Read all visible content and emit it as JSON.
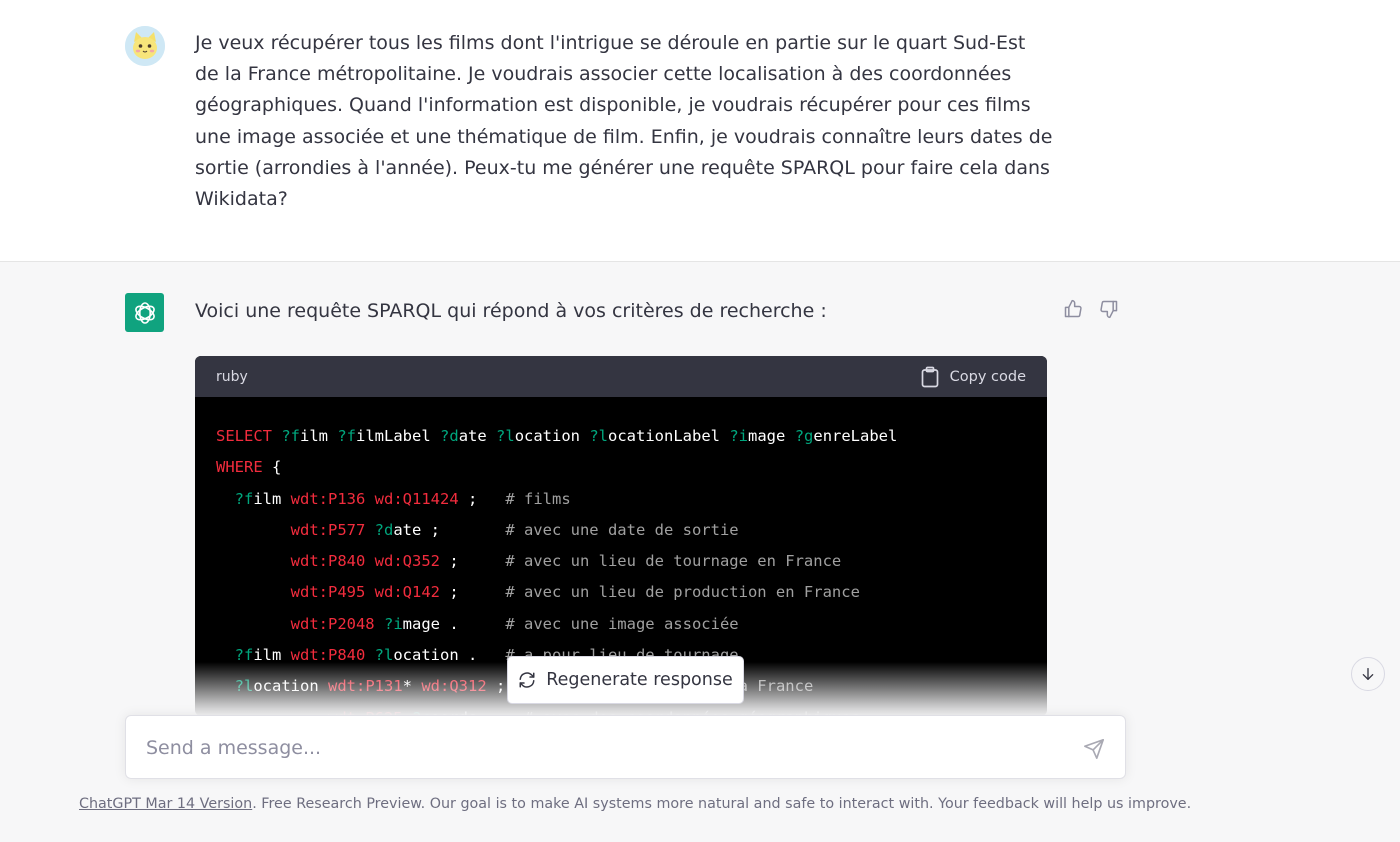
{
  "user_message": {
    "text": "Je veux récupérer tous les films dont l'intrigue se déroule en partie sur le quart Sud-Est de la France métropolitaine. Je voudrais associer cette localisation à des coordonnées géographiques. Quand l'information est disponible, je voudrais récupérer pour ces films une image associée et une thématique de film. Enfin, je voudrais connaître leurs dates de sortie (arrondies à l'année). Peux-tu me générer une requête SPARQL pour faire cela dans Wikidata?"
  },
  "assistant_message": {
    "intro": "Voici une requête SPARQL qui répond à vos critères de recherche :"
  },
  "code_block": {
    "language": "ruby",
    "copy_label": "Copy code"
  },
  "regenerate_label": "Regenerate response",
  "composer": {
    "placeholder": "Send a message..."
  },
  "footer": {
    "version_link": "ChatGPT Mar 14 Version",
    "text": ". Free Research Preview. Our goal is to make AI systems more natural and safe to interact with. Your feedback will help us improve."
  },
  "colors": {
    "accent": "#10a37f",
    "code_keyword": "#f22c3d",
    "code_variable": "#00a67d",
    "code_comment": "#a0a0a0"
  },
  "icons": {
    "assistant_avatar": "openai-logo-icon",
    "user_avatar": "cat-avatar-icon",
    "thumbs_up": "thumbs-up-icon",
    "thumbs_down": "thumbs-down-icon",
    "copy": "clipboard-icon",
    "regenerate": "refresh-icon",
    "scroll_down": "arrow-down-icon",
    "send": "paper-plane-icon"
  }
}
